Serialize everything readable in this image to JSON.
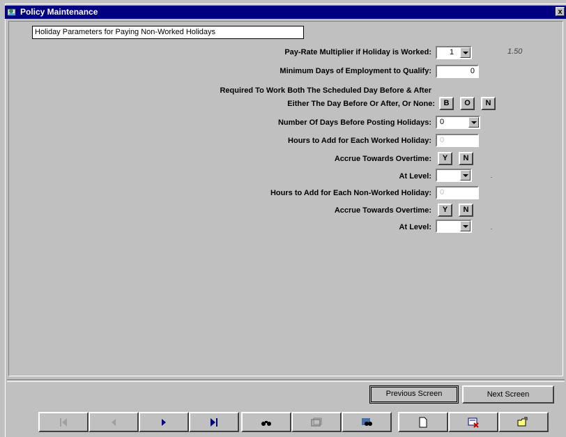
{
  "window": {
    "title": "Policy Maintenance",
    "close_label": "x"
  },
  "group_title": "Holiday Parameters for Paying Non-Worked Holidays",
  "fields": {
    "pay_rate_label": "Pay-Rate Multiplier if Holiday is Worked:",
    "pay_rate_value": "1",
    "pay_rate_display": "1.50",
    "min_days_label": "Minimum Days of Employment to Qualify:",
    "min_days_value": "0",
    "req_work_label1": "Required To Work Both The Scheduled Day Before & After",
    "req_work_label2": "Either The Day Before Or After, Or None:",
    "req_work_options": [
      "B",
      "O",
      "N"
    ],
    "days_before_label": "Number Of Days Before Posting Holidays:",
    "days_before_value": "0",
    "hours_worked_label": "Hours to Add for Each Worked Holiday:",
    "hours_worked_value": "0",
    "accrue1_label": "Accrue Towards Overtime:",
    "accrue_options": [
      "Y",
      "N"
    ],
    "at_level1_label": "At Level:",
    "hours_nonworked_label": "Hours to Add for Each Non-Worked Holiday:",
    "hours_nonworked_value": "0",
    "accrue2_label": "Accrue Towards Overtime:",
    "at_level2_label": "At Level:"
  },
  "buttons": {
    "previous": "Previous Screen",
    "next": "Next Screen"
  },
  "navigation": [
    "first-record-icon",
    "previous-record-icon",
    "next-record-icon",
    "last-record-icon",
    "find-icon",
    "view-icon",
    "search-records-icon",
    "new-document-icon",
    "delete-record-icon",
    "open-folder-icon"
  ],
  "colors": {
    "titlebar": "#000080",
    "face": "#c0c0c0",
    "play_blue": "#000080"
  }
}
